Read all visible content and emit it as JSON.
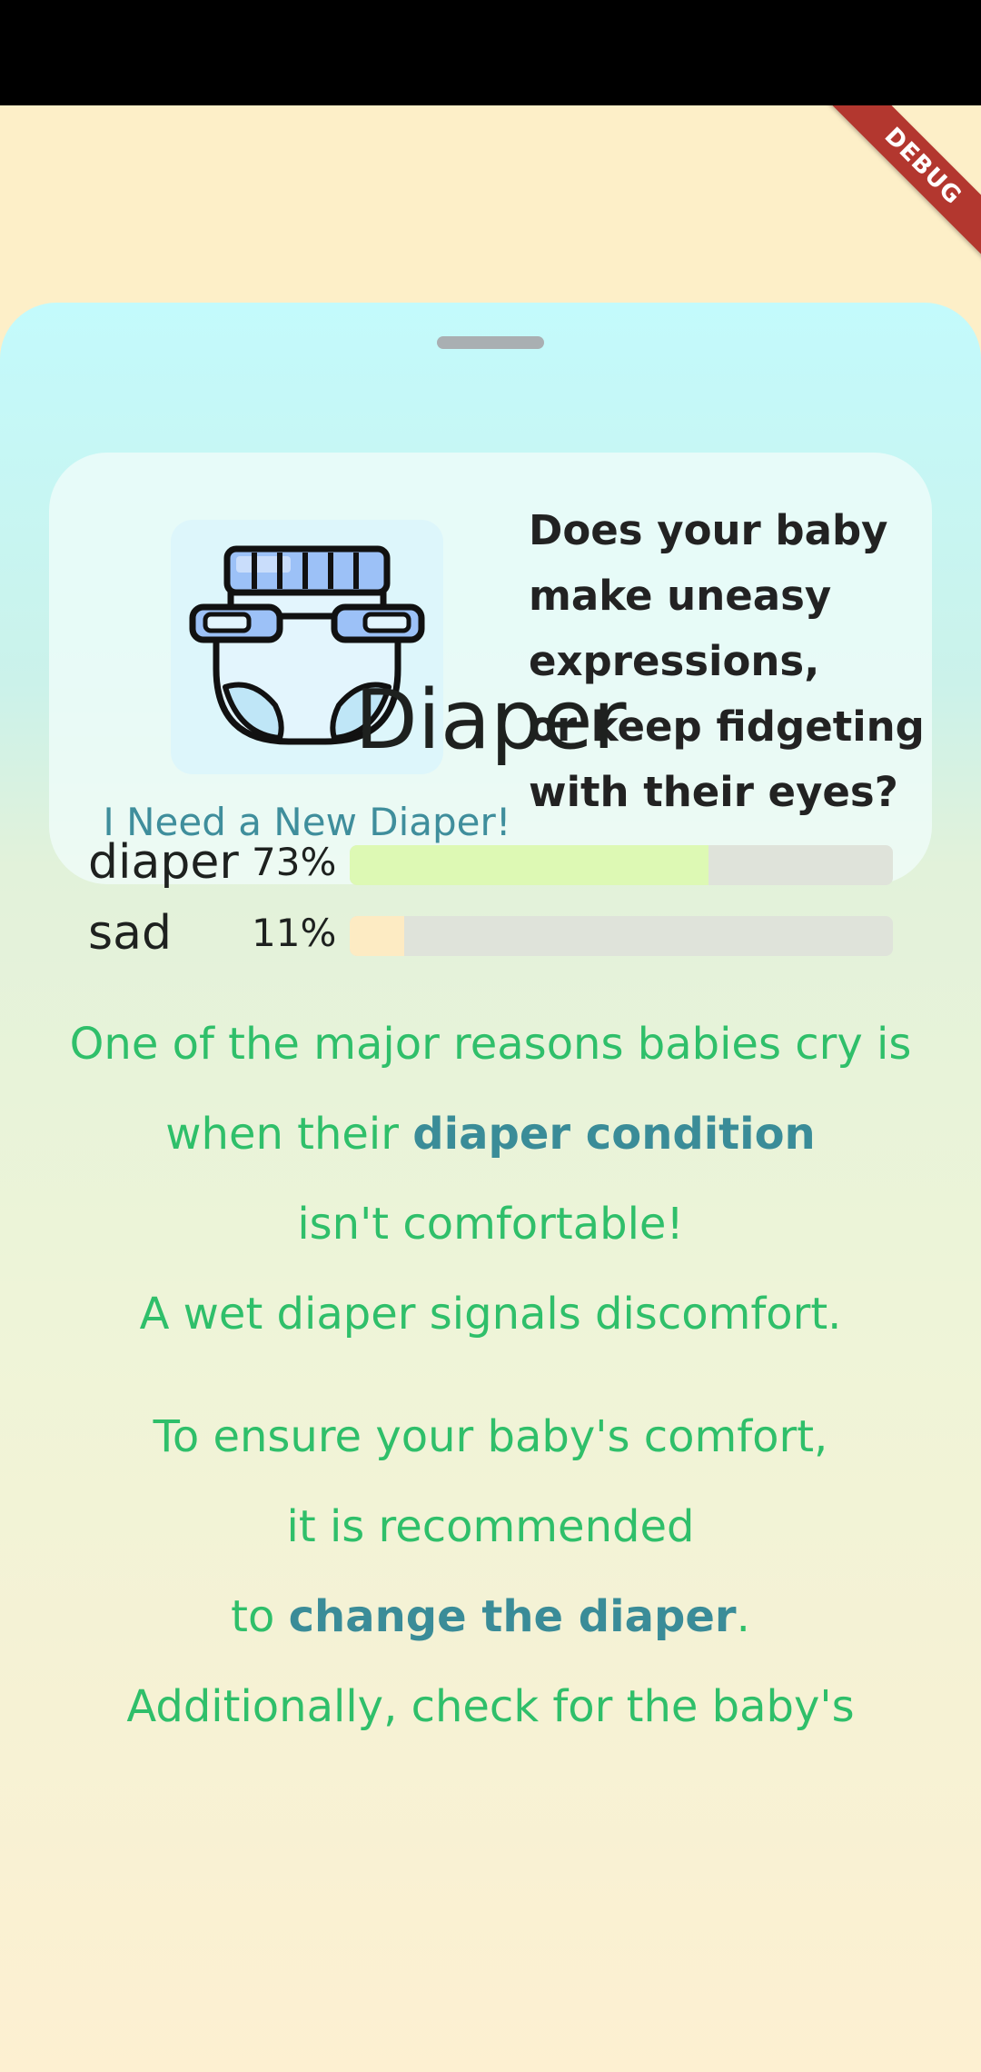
{
  "debug_banner": {
    "label": "DEBUG"
  },
  "card": {
    "caption": "I Need a New Diaper!",
    "question_lines": [
      "Does your baby",
      "make uneasy",
      "expressions,",
      "or keep fidgeting",
      "with their eyes?"
    ]
  },
  "result": {
    "title": "Diaper",
    "predictions": [
      {
        "label": "diaper",
        "percent_text": "73%",
        "value": 0.66,
        "color": "#DDF9B4"
      },
      {
        "label": "sad",
        "percent_text": "11%",
        "value": 0.1,
        "color": "#FDEBC3"
      }
    ]
  },
  "explanation": {
    "p1_l1": "One of the major reasons babies cry is",
    "p1_l2_pre": "when their ",
    "p1_l2_bold": "diaper condition",
    "p1_l3": "isn't comfortable!",
    "p1_l4": "A wet diaper signals discomfort.",
    "p2_l1": "To ensure your baby's comfort,",
    "p2_l2": "it is recommended",
    "p2_l3_pre": "to ",
    "p2_l3_bold": "change the diaper",
    "p2_l3_post": ".",
    "p2_l4": "Additionally, check for the baby's"
  },
  "colors": {
    "accent_teal": "#3A8C98",
    "text_green": "#2FBF6A",
    "debug_red": "#B3372F"
  },
  "icons": [
    "diaper-icon"
  ]
}
